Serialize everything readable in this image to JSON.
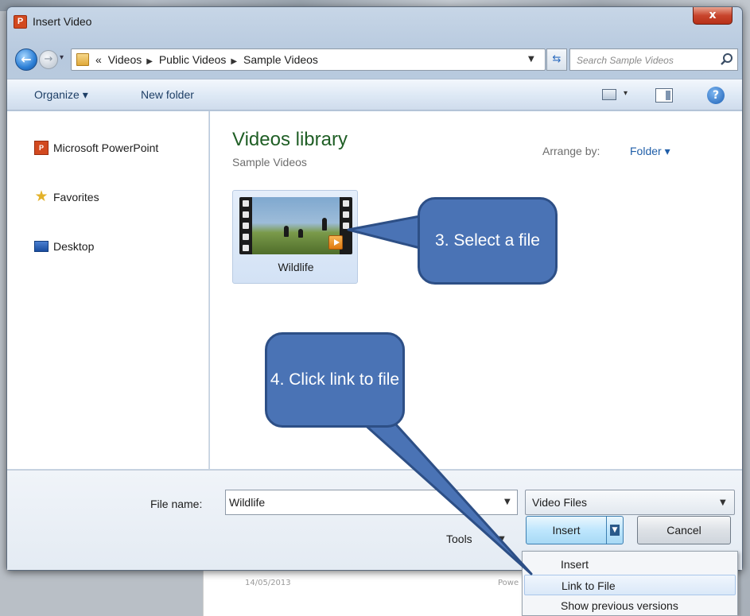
{
  "window": {
    "title": "Insert Video",
    "app_icon_letter": "P",
    "close_label": "x"
  },
  "address_bar": {
    "breadcrumb_prefix": "«",
    "crumbs": [
      "Videos",
      "Public Videos",
      "Sample Videos"
    ],
    "search_placeholder": "Search Sample Videos"
  },
  "toolbar": {
    "organize_label": "Organize ▾",
    "new_folder_label": "New folder"
  },
  "nav_pane": {
    "items": [
      {
        "label": "Microsoft PowerPoint",
        "icon": "powerpoint-icon"
      },
      {
        "label": "Favorites",
        "icon": "star-icon"
      },
      {
        "label": "Desktop",
        "icon": "desktop-icon"
      }
    ]
  },
  "library": {
    "title": "Videos library",
    "subtitle": "Sample Videos",
    "arrange_label": "Arrange by:",
    "arrange_value": "Folder ▾"
  },
  "files": [
    {
      "name": "Wildlife",
      "icon": "video-file-icon"
    }
  ],
  "bottom": {
    "file_name_label": "File name:",
    "file_name_value": "Wildlife",
    "file_type_value": "Video Files",
    "tools_label": "Tools",
    "insert_label": "Insert",
    "cancel_label": "Cancel"
  },
  "insert_menu": {
    "items": [
      "Insert",
      "Link to File",
      "Show previous versions"
    ],
    "highlighted_index": 1
  },
  "background_doc": {
    "date": "14/05/2013",
    "text": "Powe"
  },
  "callouts": {
    "step3": "3. Select a file",
    "step4": "4. Click link to file"
  },
  "colors": {
    "callout_fill": "#4a73b5",
    "library_title": "#1f5e25",
    "accent_link": "#1f5ea8"
  }
}
